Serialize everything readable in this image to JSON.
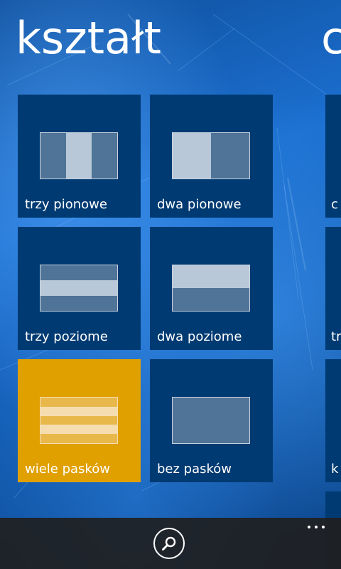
{
  "pivot": {
    "title": "kształt",
    "next_title_peek": "c"
  },
  "tiles": [
    {
      "label": "trzy pionowe",
      "preview": "three-vertical",
      "active": false
    },
    {
      "label": "dwa pionowe",
      "preview": "two-vertical",
      "active": false
    },
    {
      "label": "trzy poziome",
      "preview": "three-horizontal",
      "active": false
    },
    {
      "label": "dwa poziome",
      "preview": "two-horizontal",
      "active": false
    },
    {
      "label": "wiele pasków",
      "preview": "many-stripes",
      "active": true
    },
    {
      "label": "bez pasków",
      "preview": "no-stripes",
      "active": false
    }
  ],
  "peek_tiles": [
    {
      "label": "c"
    },
    {
      "label": "tr"
    },
    {
      "label": "k"
    }
  ],
  "app_bar": {
    "search_icon": "search-icon",
    "more_icon": "more-dots-icon"
  },
  "colors": {
    "tile_background": "#003a72",
    "accent": "#e0a000"
  }
}
